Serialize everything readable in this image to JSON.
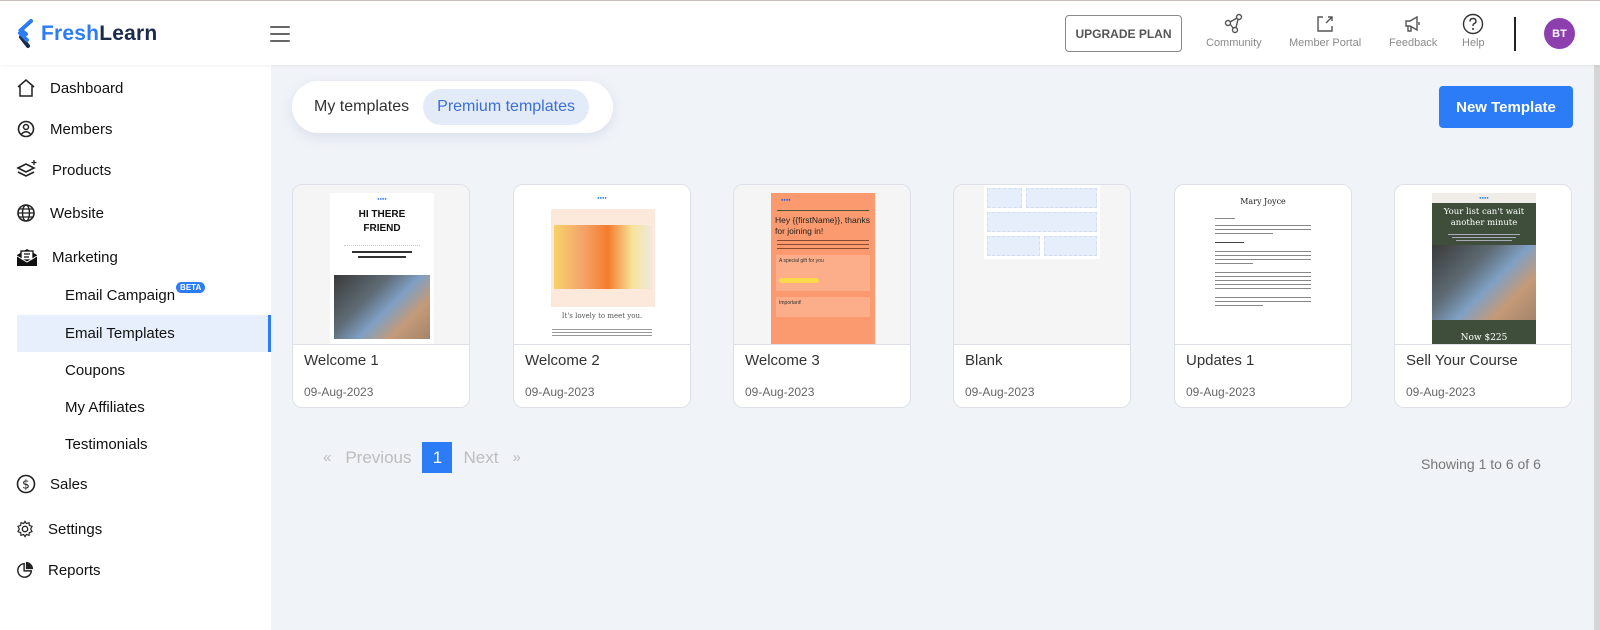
{
  "app": {
    "logo_part1": "Fresh",
    "logo_part2": "Learn",
    "brand_color": "#2b7cf6"
  },
  "header": {
    "upgrade_label": "UPGRADE PLAN",
    "items": [
      {
        "label": "Community",
        "icon": "community-icon"
      },
      {
        "label": "Member Portal",
        "icon": "external-link-icon"
      },
      {
        "label": "Feedback",
        "icon": "megaphone-icon"
      },
      {
        "label": "Help",
        "icon": "help-icon"
      }
    ],
    "avatar_initials": "BT",
    "avatar_color": "#8e3fae"
  },
  "sidebar": {
    "items": [
      {
        "label": "Dashboard",
        "icon": "home-icon"
      },
      {
        "label": "Members",
        "icon": "user-circle-icon"
      },
      {
        "label": "Products",
        "icon": "layers-plus-icon"
      },
      {
        "label": "Website",
        "icon": "globe-icon"
      },
      {
        "label": "Marketing",
        "icon": "mail-open-icon"
      }
    ],
    "marketing_sub": [
      {
        "label": "Email Campaign",
        "badge": "BETA"
      },
      {
        "label": "Email Templates",
        "active": true
      },
      {
        "label": "Coupons"
      },
      {
        "label": "My Affiliates"
      },
      {
        "label": "Testimonials"
      }
    ],
    "bottom_items": [
      {
        "label": "Sales",
        "icon": "dollar-circle-icon"
      },
      {
        "label": "Settings",
        "icon": "gear-icon"
      },
      {
        "label": "Reports",
        "icon": "pie-chart-icon"
      }
    ]
  },
  "main": {
    "tabs": [
      {
        "label": "My templates",
        "active": false
      },
      {
        "label": "Premium templates",
        "active": true
      }
    ],
    "new_template_label": "New Template",
    "templates": [
      {
        "name": "Welcome 1",
        "date": "09-Aug-2023",
        "thumb_heading": "HI THERE FRIEND"
      },
      {
        "name": "Welcome 2",
        "date": "09-Aug-2023",
        "thumb_heading": "It's lovely to meet you."
      },
      {
        "name": "Welcome 3",
        "date": "09-Aug-2023",
        "thumb_heading": "Hey {{firstName}}, thanks for joining in!",
        "thumb_sub1": "A special gift for you",
        "thumb_sub2": "Important!"
      },
      {
        "name": "Blank",
        "date": "09-Aug-2023"
      },
      {
        "name": "Updates 1",
        "date": "09-Aug-2023",
        "thumb_heading": "Mary Joyce"
      },
      {
        "name": "Sell Your Course",
        "date": "09-Aug-2023",
        "thumb_heading": "Your list can't wait another minute",
        "thumb_footer": "Now $225"
      }
    ],
    "pagination": {
      "prev_symbol": "«",
      "prev_label": "Previous",
      "current_page": "1",
      "next_label": "Next",
      "next_symbol": "»"
    },
    "showing_text": "Showing 1 to 6 of 6"
  }
}
